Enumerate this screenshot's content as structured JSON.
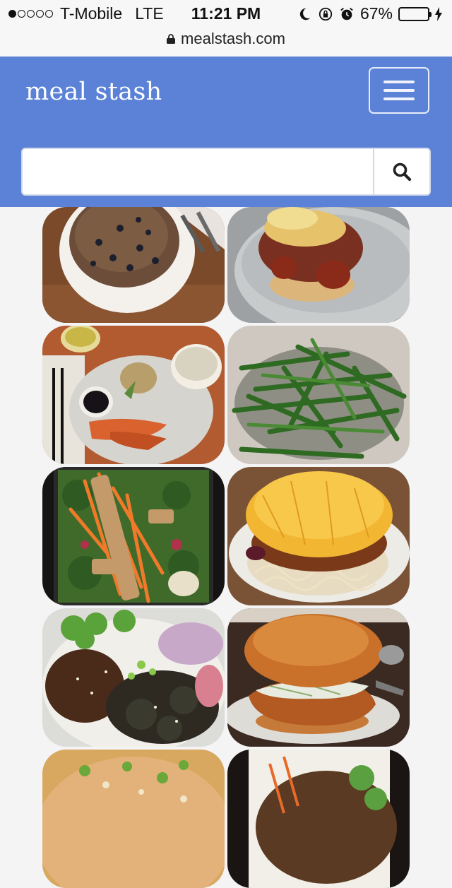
{
  "status_bar": {
    "carrier": "T-Mobile",
    "network": "LTE",
    "time": "11:21 PM",
    "battery_percent": "67%",
    "battery_level": 0.67,
    "url": "mealstash.com"
  },
  "header": {
    "brand": "meal stash",
    "menu_icon": "hamburger-menu-icon",
    "accent_color": "#5b82d6"
  },
  "search": {
    "value": "",
    "placeholder": "",
    "icon": "search-icon"
  },
  "meals": [
    {
      "kind": "blueberry-pancake"
    },
    {
      "kind": "biscuit-sandwich"
    },
    {
      "kind": "salmon-plate"
    },
    {
      "kind": "green-beans"
    },
    {
      "kind": "kale-salad"
    },
    {
      "kind": "cincinnati-chili"
    },
    {
      "kind": "teriyaki-bowl"
    },
    {
      "kind": "fried-chicken-sandwich"
    },
    {
      "kind": "noodle-bowl"
    },
    {
      "kind": "veggie-bowl"
    }
  ]
}
